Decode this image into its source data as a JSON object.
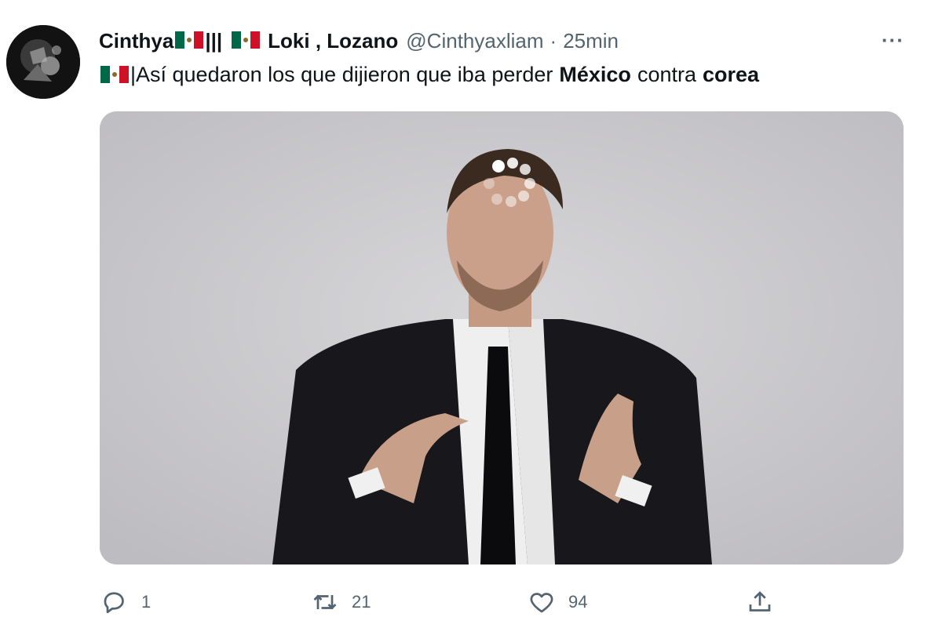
{
  "tweet": {
    "display_name": "Cinthya",
    "name_bars": "|||",
    "name_suffix": "Loki , Lozano",
    "handle": "@Cinthyaxliam",
    "separator": "·",
    "time": "25min",
    "more_label": "···",
    "text": {
      "prefix": "|Así quedaron los que dijieron que iba perder",
      "bold1": "México",
      "middle": "contra",
      "bold2": "corea"
    },
    "media_alt": "Loki GIF"
  },
  "actions": {
    "reply_count": "1",
    "retweet_count": "21",
    "like_count": "94"
  },
  "icons": {
    "more": "more-icon",
    "reply": "reply-icon",
    "retweet": "retweet-icon",
    "like": "heart-icon",
    "share": "share-icon",
    "flag": "mexico-flag-icon"
  },
  "colors": {
    "text": "#0f1419",
    "secondary": "#536471",
    "flag_green": "#006847",
    "flag_red": "#ce1126"
  }
}
